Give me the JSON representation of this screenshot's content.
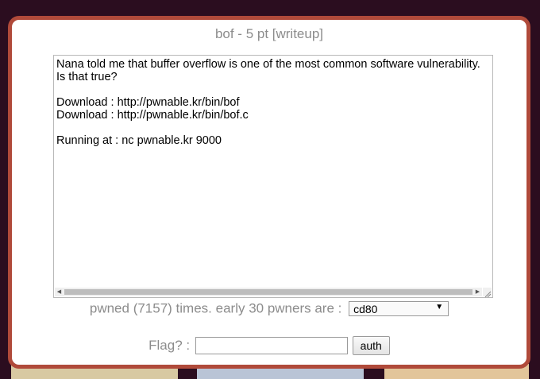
{
  "modal": {
    "title": "bof - 5 pt [writeup]",
    "description": "Nana told me that buffer overflow is one of the most common software vulnerability.\nIs that true?\n\nDownload : http://pwnable.kr/bin/bof\nDownload : http://pwnable.kr/bin/bof.c\n\nRunning at : nc pwnable.kr 9000",
    "pwned_text": "pwned (7157) times. early 30 pwners are :",
    "pwners_selected": "cd80",
    "flag_label": "Flag? :",
    "flag_value": "",
    "auth_label": "auth"
  },
  "colors": {
    "modal_border": "#b04a3a",
    "label_gray": "#8c8c8c",
    "background": "#2b0d1f"
  },
  "icons": {
    "scroll_left": "chevron-left-icon",
    "scroll_right": "chevron-right-icon",
    "select_caret": "caret-down-icon",
    "resize": "resize-grip-icon"
  }
}
